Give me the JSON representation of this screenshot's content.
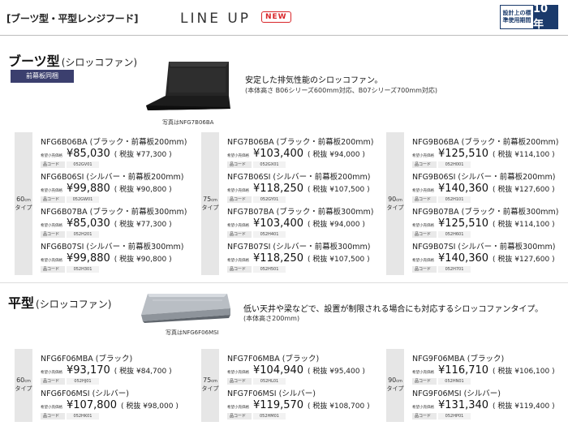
{
  "header": {
    "series_title": "[ブーツ型・平型レンジフード]",
    "lineup": "LINE UP",
    "new_badge": "NEW",
    "warranty_text": "設計上の標準使用期間",
    "warranty_years": "10年"
  },
  "boots": {
    "title": "ブーツ型",
    "subtitle": "(シロッコファン)",
    "tag": "前幕板同梱",
    "image_caption": "写真はNFG7B06BA",
    "description": "安定した排気性能のシロッコファン。",
    "description_sub": "(本体高さ B06シリーズ600mm対応、B07シリーズ700mm対応)",
    "columns": [
      {
        "width_num": "60",
        "width_unit": "cm",
        "width_type": "タイプ",
        "products": [
          {
            "model": "NFG6B06BA (ブラック・前幕板200mm)",
            "price_label": "希望小売価格",
            "price": "¥85,030",
            "tax": "( 税抜 ¥77,300 )",
            "code_label": "品コード",
            "code": "052GV01"
          },
          {
            "model": "NFG6B06SI (シルバー・前幕板200mm)",
            "price_label": "希望小売価格",
            "price": "¥99,880",
            "tax": "( 税抜 ¥90,800 )",
            "code_label": "品コード",
            "code": "052GW01"
          },
          {
            "model": "NFG6B07BA (ブラック・前幕板300mm)",
            "price_label": "希望小売価格",
            "price": "¥85,030",
            "tax": "( 税抜 ¥77,300 )",
            "code_label": "品コード",
            "code": "052H201"
          },
          {
            "model": "NFG6B07SI (シルバー・前幕板300mm)",
            "price_label": "希望小売価格",
            "price": "¥99,880",
            "tax": "( 税抜 ¥90,800 )",
            "code_label": "品コード",
            "code": "052H301"
          }
        ]
      },
      {
        "width_num": "75",
        "width_unit": "cm",
        "width_type": "タイプ",
        "products": [
          {
            "model": "NFG7B06BA (ブラック・前幕板200mm)",
            "price_label": "希望小売価格",
            "price": "¥103,400",
            "tax": "( 税抜 ¥94,000 )",
            "code_label": "品コード",
            "code": "052GX01"
          },
          {
            "model": "NFG7B06SI (シルバー・前幕板200mm)",
            "price_label": "希望小売価格",
            "price": "¥118,250",
            "tax": "( 税抜 ¥107,500 )",
            "code_label": "品コード",
            "code": "052GY01"
          },
          {
            "model": "NFG7B07BA (ブラック・前幕板300mm)",
            "price_label": "希望小売価格",
            "price": "¥103,400",
            "tax": "( 税抜 ¥94,000 )",
            "code_label": "品コード",
            "code": "052H401"
          },
          {
            "model": "NFG7B07SI (シルバー・前幕板300mm)",
            "price_label": "希望小売価格",
            "price": "¥118,250",
            "tax": "( 税抜 ¥107,500 )",
            "code_label": "品コード",
            "code": "052H501"
          }
        ]
      },
      {
        "width_num": "90",
        "width_unit": "cm",
        "width_type": "タイプ",
        "products": [
          {
            "model": "NFG9B06BA (ブラック・前幕板200mm)",
            "price_label": "希望小売価格",
            "price": "¥125,510",
            "tax": "( 税抜 ¥114,100 )",
            "code_label": "品コード",
            "code": "052H001"
          },
          {
            "model": "NFG9B06SI (シルバー・前幕板200mm)",
            "price_label": "希望小売価格",
            "price": "¥140,360",
            "tax": "( 税抜 ¥127,600 )",
            "code_label": "品コード",
            "code": "052H101"
          },
          {
            "model": "NFG9B07BA (ブラック・前幕板300mm)",
            "price_label": "希望小売価格",
            "price": "¥125,510",
            "tax": "( 税抜 ¥114,100 )",
            "code_label": "品コード",
            "code": "052H601"
          },
          {
            "model": "NFG9B07SI (シルバー・前幕板300mm)",
            "price_label": "希望小売価格",
            "price": "¥140,360",
            "tax": "( 税抜 ¥127,600 )",
            "code_label": "品コード",
            "code": "052H701"
          }
        ]
      }
    ]
  },
  "flat": {
    "title": "平型",
    "subtitle": "(シロッコファン)",
    "image_caption": "写真はNFG6F06MSI",
    "description": "低い天井や梁などで、設置が制限される場合にも対応するシロッコファンタイプ。",
    "description_sub": "(本体高さ200mm)",
    "columns": [
      {
        "width_num": "60",
        "width_unit": "cm",
        "width_type": "タイプ",
        "products": [
          {
            "model": "NFG6F06MBA (ブラック)",
            "price_label": "希望小売価格",
            "price": "¥93,170",
            "tax": "( 税抜 ¥84,700 )",
            "code_label": "品コード",
            "code": "052HJ01"
          },
          {
            "model": "NFG6F06MSI (シルバー)",
            "price_label": "希望小売価格",
            "price": "¥107,800",
            "tax": "( 税抜 ¥98,000 )",
            "code_label": "品コード",
            "code": "052HK01"
          }
        ]
      },
      {
        "width_num": "75",
        "width_unit": "cm",
        "width_type": "タイプ",
        "products": [
          {
            "model": "NFG7F06MBA (ブラック)",
            "price_label": "希望小売価格",
            "price": "¥104,940",
            "tax": "( 税抜 ¥95,400 )",
            "code_label": "品コード",
            "code": "052HL01"
          },
          {
            "model": "NFG7F06MSI (シルバー)",
            "price_label": "希望小売価格",
            "price": "¥119,570",
            "tax": "( 税抜 ¥108,700 )",
            "code_label": "品コード",
            "code": "052HM01"
          }
        ]
      },
      {
        "width_num": "90",
        "width_unit": "cm",
        "width_type": "タイプ",
        "products": [
          {
            "model": "NFG9F06MBA (ブラック)",
            "price_label": "希望小売価格",
            "price": "¥116,710",
            "tax": "( 税抜 ¥106,100 )",
            "code_label": "品コード",
            "code": "052HN01"
          },
          {
            "model": "NFG9F06MSI (シルバー)",
            "price_label": "希望小売価格",
            "price": "¥131,340",
            "tax": "( 税抜 ¥119,400 )",
            "code_label": "品コード",
            "code": "052HP01"
          }
        ]
      }
    ]
  },
  "colors": {
    "tag_bg": "#3b3f6e",
    "badge_red": "#d9262a",
    "warranty_navy": "#1a3a6b"
  }
}
